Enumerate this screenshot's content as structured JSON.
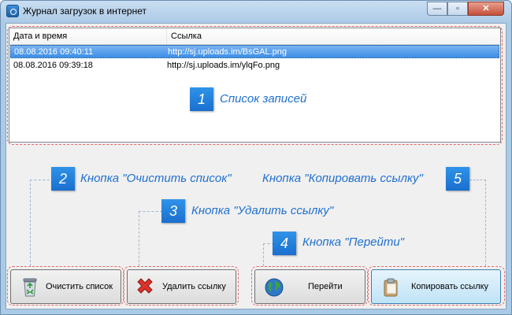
{
  "window": {
    "title": "Журнал загрузок в интернет",
    "icon": "camera-icon",
    "min_glyph": "—",
    "max_glyph": "▫",
    "close_glyph": "✕"
  },
  "list": {
    "columns": [
      "Дата и время",
      "Ссылка"
    ],
    "rows": [
      {
        "datetime": "08.08.2016 09:40:11",
        "link": "http://sj.uploads.im/BsGAL.png",
        "selected": true
      },
      {
        "datetime": "08.08.2016 09:39:18",
        "link": "http://sj.uploads.im/ylqFo.png",
        "selected": false
      }
    ]
  },
  "annotations": [
    {
      "number": "1",
      "text": "Список записей"
    },
    {
      "number": "2",
      "text": "Кнопка \"Очистить список\""
    },
    {
      "number": "3",
      "text": "Кнопка \"Удалить ссылку\""
    },
    {
      "number": "4",
      "text": "Кнопка \"Перейти\""
    },
    {
      "number": "5",
      "text": "Кнопка \"Копировать ссылку\""
    }
  ],
  "buttons": {
    "clear": {
      "label": "Очистить список",
      "icon": "recycle-bin-icon"
    },
    "delete": {
      "label": "Удалить ссылку",
      "icon": "red-x-icon"
    },
    "go": {
      "label": "Перейти",
      "icon": "globe-icon"
    },
    "copy": {
      "label": "Копировать ссылку",
      "icon": "clipboard-icon"
    }
  },
  "colors": {
    "accent": "#1f6fd0",
    "selection": "#3d8ee6",
    "highlight_dash": "#e36a6a"
  }
}
